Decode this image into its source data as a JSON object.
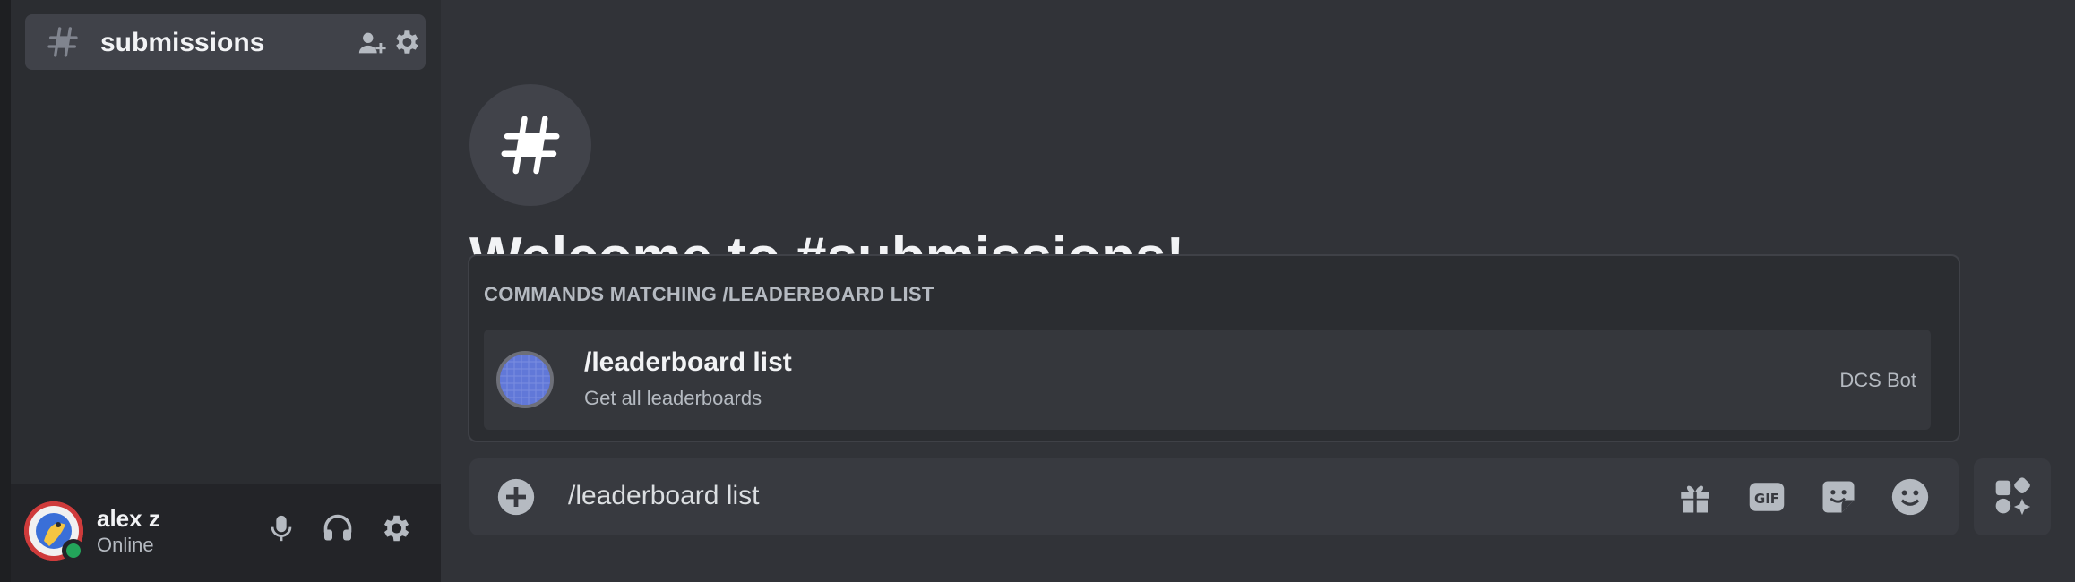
{
  "channel": {
    "name": "submissions",
    "icon": "hash-icon",
    "actions": [
      "invite-icon",
      "gear-icon"
    ]
  },
  "welcome": {
    "title": "Welcome to #submissions!"
  },
  "command_popup": {
    "header": "COMMANDS MATCHING /LEADERBOARD LIST",
    "items": [
      {
        "name": "/leaderboard list",
        "description": "Get all leaderboards",
        "source": "DCS Bot"
      }
    ]
  },
  "composer": {
    "value": "/leaderboard list",
    "buttons": [
      "gift-icon",
      "gif-icon",
      "sticker-icon",
      "emoji-icon",
      "apps-icon"
    ]
  },
  "user": {
    "name": "alex z",
    "status": "Online",
    "status_color": "#23a55a",
    "controls": [
      "microphone-icon",
      "headphones-icon",
      "gear-icon"
    ]
  },
  "colors": {
    "background": "#313338",
    "sidebar": "#2b2d31",
    "user_panel": "#232428",
    "accent": "#5865f2"
  }
}
